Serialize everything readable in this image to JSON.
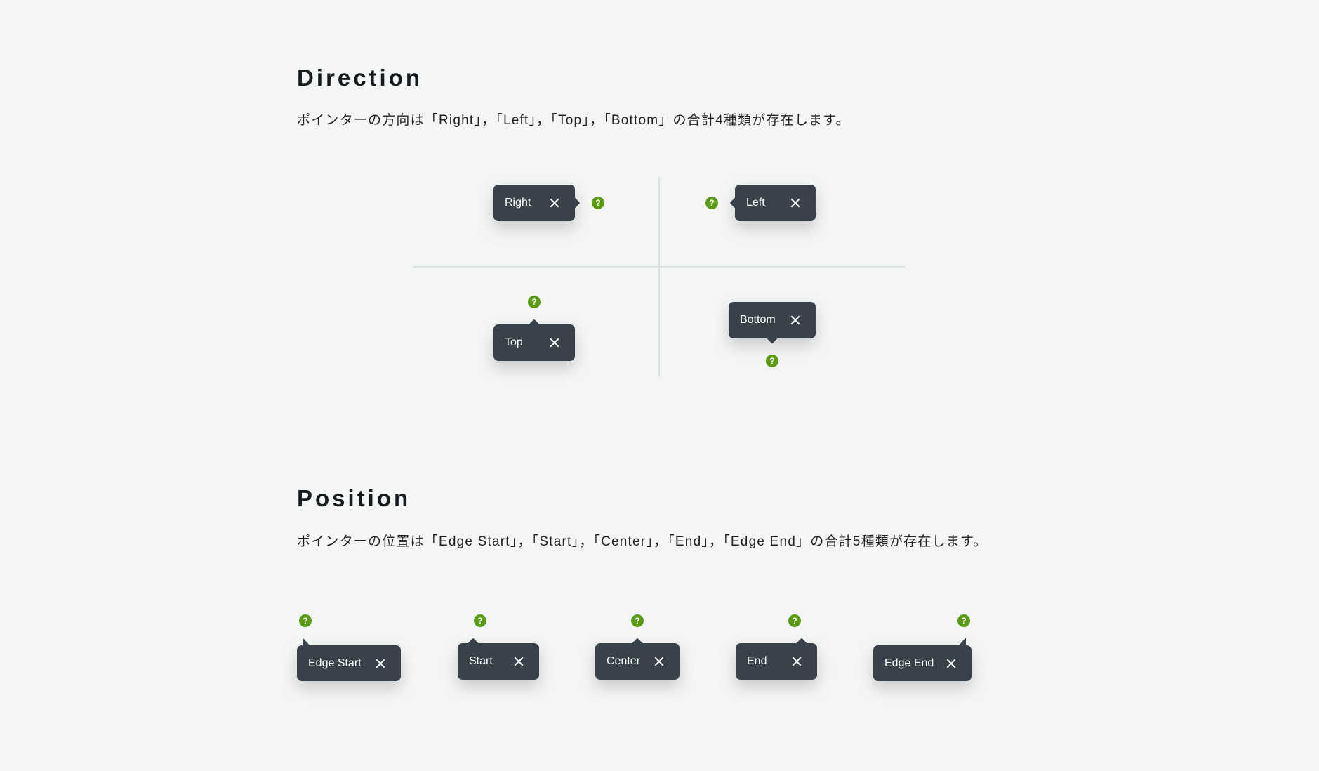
{
  "direction": {
    "title": "Direction",
    "description": "ポインターの方向は「Right」，「Left」，「Top」，「Bottom」の合計4種類が存在します。",
    "tooltips": [
      {
        "label": "Right",
        "pointer": "right"
      },
      {
        "label": "Left",
        "pointer": "left"
      },
      {
        "label": "Top",
        "pointer": "top"
      },
      {
        "label": "Bottom",
        "pointer": "bottom"
      }
    ]
  },
  "position": {
    "title": "Position",
    "description": "ポインターの位置は「Edge Start」，「Start」，「Center」，「End」，「Edge End」の合計5種類が存在します。",
    "tooltips": [
      {
        "label": "Edge Start"
      },
      {
        "label": "Start"
      },
      {
        "label": "Center"
      },
      {
        "label": "End"
      },
      {
        "label": "Edge End"
      }
    ]
  },
  "help_glyph": "?",
  "colors": {
    "background": "#f4f6f5",
    "tooltip": "#39414a",
    "help_icon": "#5a9a14"
  },
  "icons": {
    "close": "close-icon",
    "help": "help-circle-icon"
  }
}
